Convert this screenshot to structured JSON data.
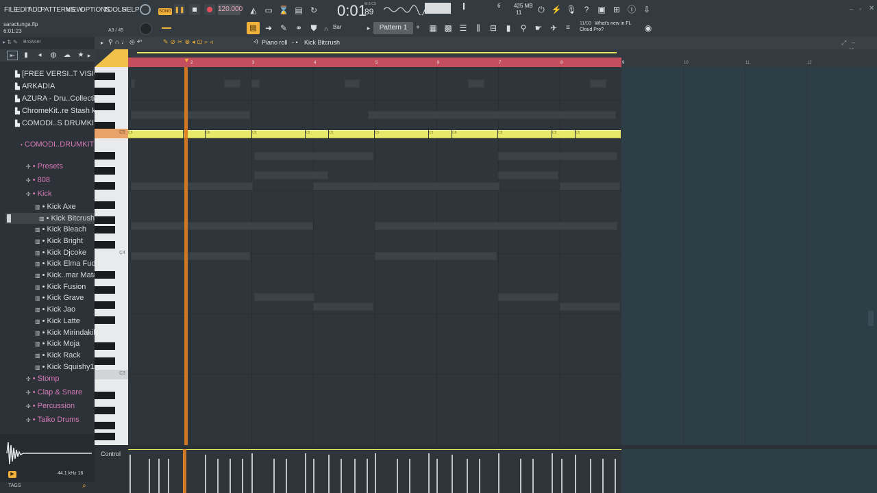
{
  "menu": [
    "FILE",
    "EDIT",
    "ADD",
    "PATTERNS",
    "VIEW",
    "OPTIONS",
    "TOOLS",
    "HELP"
  ],
  "transport": {
    "tempo": "120.000",
    "song_label": "SONG",
    "time": "0:01",
    "time_sub": "89",
    "time_unit": "M:S:CS"
  },
  "cpu": {
    "voices": "6",
    "mem": "425 MB",
    "val2": "11"
  },
  "project": {
    "file": "saractunga.flp",
    "time": "6:01:23",
    "pos": "A3 / 45"
  },
  "pattern": {
    "snap": "Bar",
    "name": "Pattern 1"
  },
  "news": {
    "date": "11/03",
    "text1": "What's new in FL",
    "text2": "Cloud Pro?"
  },
  "browser": {
    "title": "Browser",
    "items": [
      {
        "label": "[FREE VERSI..T VISION'",
        "kind": "folder"
      },
      {
        "label": "ARKADIA",
        "kind": "folder"
      },
      {
        "label": "AZURA - Dru..Collection",
        "kind": "folder"
      },
      {
        "label": "ChromeKit..re Stash kit",
        "kind": "folder"
      },
      {
        "label": "COMODI..S DRUMKIT",
        "kind": "folder"
      },
      {
        "label": "COMODI..DRUMKIT",
        "kind": "open"
      },
      {
        "label": "Presets",
        "kind": "sub"
      },
      {
        "label": "808",
        "kind": "sub"
      },
      {
        "label": "Kick",
        "kind": "sub"
      },
      {
        "label": "Kick Axe",
        "kind": "file"
      },
      {
        "label": "Kick Bitcrush",
        "kind": "file-selected"
      },
      {
        "label": "Kick Bleach",
        "kind": "file"
      },
      {
        "label": "Kick Bright",
        "kind": "file"
      },
      {
        "label": "Kick Djcoke",
        "kind": "file"
      },
      {
        "label": "Kick Elma Fudd",
        "kind": "file"
      },
      {
        "label": "Kick..mar Mata",
        "kind": "file"
      },
      {
        "label": "Kick Fusion",
        "kind": "file"
      },
      {
        "label": "Kick Grave",
        "kind": "file"
      },
      {
        "label": "Kick Jao",
        "kind": "file"
      },
      {
        "label": "Kick Latte",
        "kind": "file"
      },
      {
        "label": "Kick Mirindakik",
        "kind": "file"
      },
      {
        "label": "Kick Moja",
        "kind": "file"
      },
      {
        "label": "Kick Rack",
        "kind": "file"
      },
      {
        "label": "Kick Squishy1",
        "kind": "file"
      },
      {
        "label": "Stomp",
        "kind": "sub"
      },
      {
        "label": "Clap & Snare",
        "kind": "sub"
      },
      {
        "label": "Percussion",
        "kind": "sub"
      },
      {
        "label": "Taiko Drums",
        "kind": "sub"
      }
    ],
    "sample_info": "44.1 kHz 16",
    "tags": "TAGS"
  },
  "piano_roll": {
    "title": "Piano roll",
    "target": "Kick Bitcrush",
    "bars": [
      "2",
      "3",
      "4",
      "5",
      "6",
      "7",
      "8",
      "9",
      "10",
      "11",
      "12"
    ],
    "key_labels": [
      "C5",
      "C4",
      "C3"
    ],
    "note_label": "C5",
    "control": "Control"
  },
  "colors": {
    "note": "#e8e86a",
    "playhead": "#e07d22",
    "accent": "#f2b13a",
    "timeline_loop": "#c34f5e",
    "browser_text": "#d7dde2",
    "browser_pink": "#d77bb9"
  }
}
